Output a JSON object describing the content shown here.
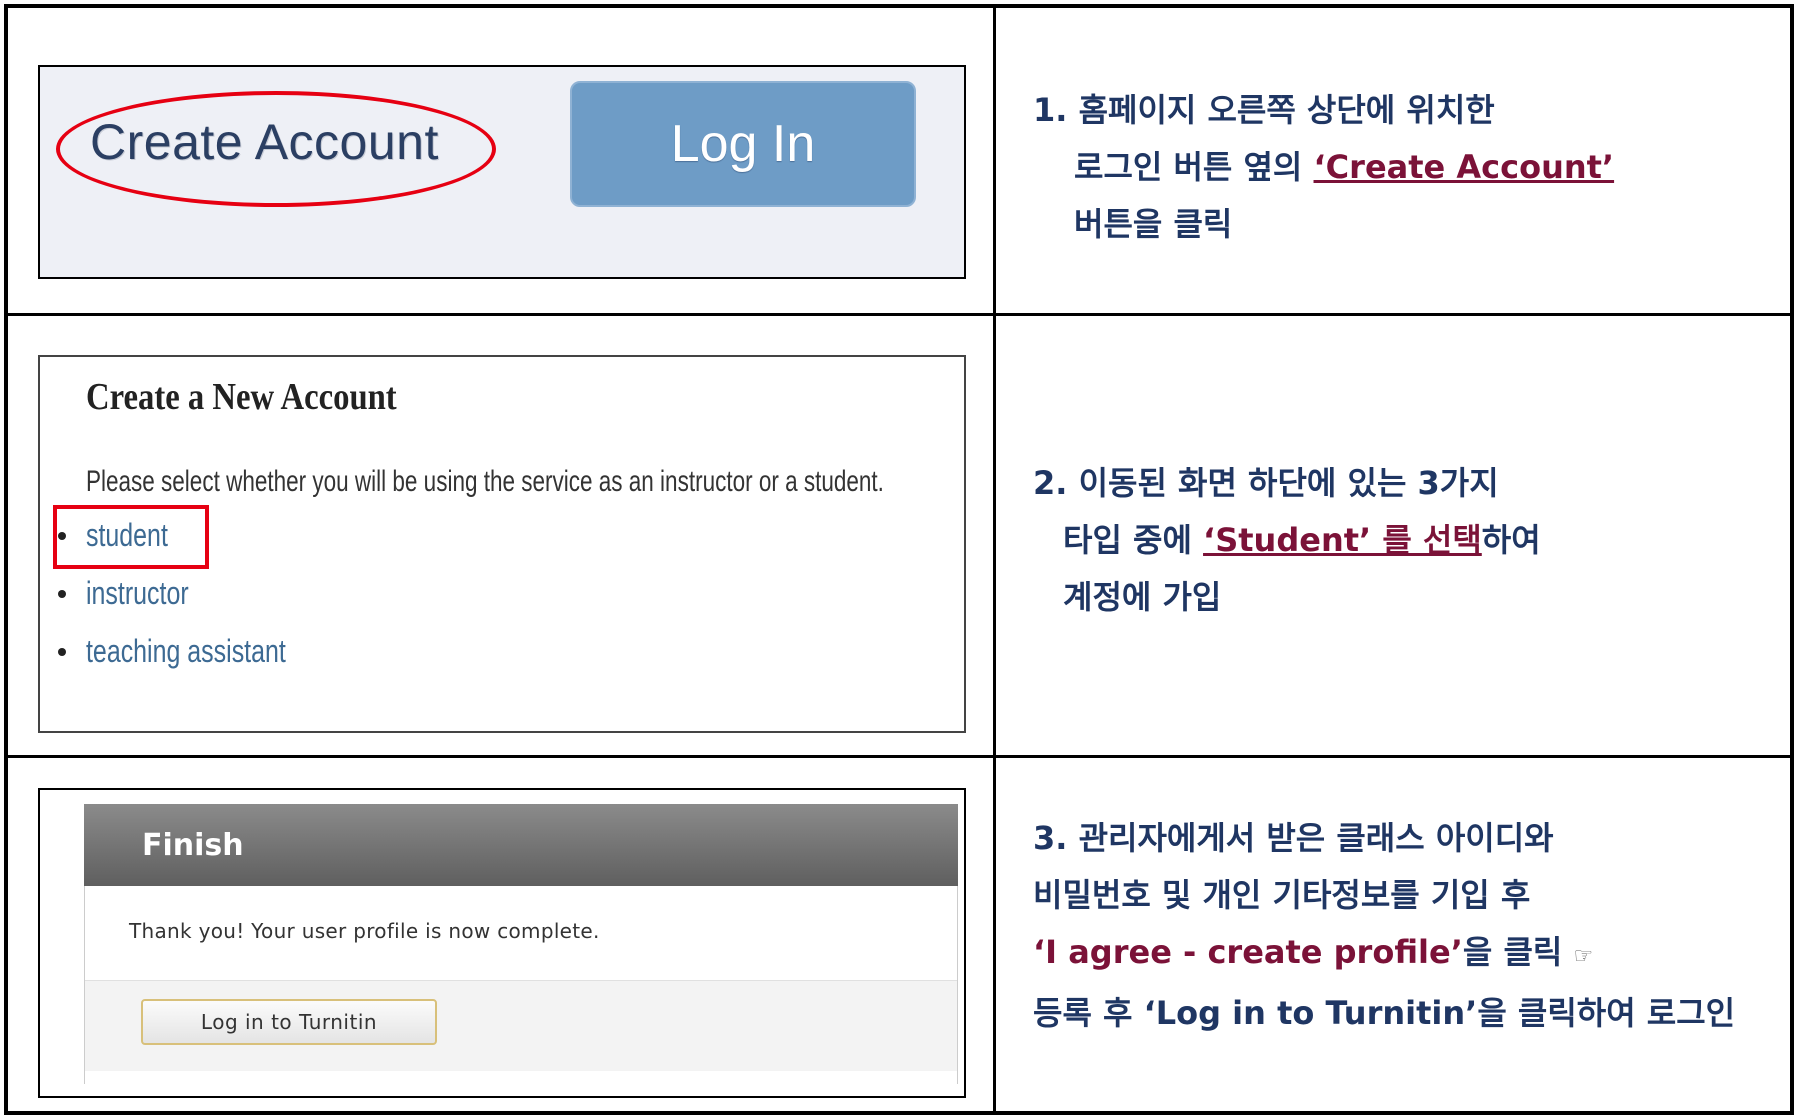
{
  "row1": {
    "create_account_label": "Create Account",
    "login_label": "Log In",
    "instruction": {
      "line1": "1. 홈페이지 오른쪽 상단에 위치한",
      "line2_prefix": "로그인 버튼 옆의 ",
      "line2_link": "‘Create Account’",
      "line3": "버튼을 클릭"
    }
  },
  "row2": {
    "title": "Create a New Account",
    "description": "Please select whether you will be using the service as an instructor or a student.",
    "options": [
      "student",
      "instructor",
      "teaching assistant"
    ],
    "instruction": {
      "line1": "2. 이동된 화면 하단에 있는 3가지",
      "line2_prefix": "타입 중에 ",
      "line2_link": "‘Student’ 를 선택",
      "line2_suffix": "하여",
      "line3": "계정에 가입"
    }
  },
  "row3": {
    "finish_title": "Finish",
    "thank_you_text": "Thank you! Your user profile is now complete.",
    "button_label": "Log in to Turnitin",
    "instruction": {
      "line1": "3. 관리자에게서 받은 클래스 아이디와",
      "line2": "비밀번호 및 개인 기타정보를 기입 후",
      "line3_highlight": "‘I agree - create profile’",
      "line3_suffix": "을 클릭 ",
      "line3_icon": "☞",
      "line4": "등록 후 ‘Log in to Turnitin’을 클릭하여 로그인"
    }
  },
  "colors": {
    "instruction_text": "#1f3663",
    "highlight": "#7b1238",
    "annotation_red": "#e60012",
    "login_button": "#6e9cc6"
  }
}
